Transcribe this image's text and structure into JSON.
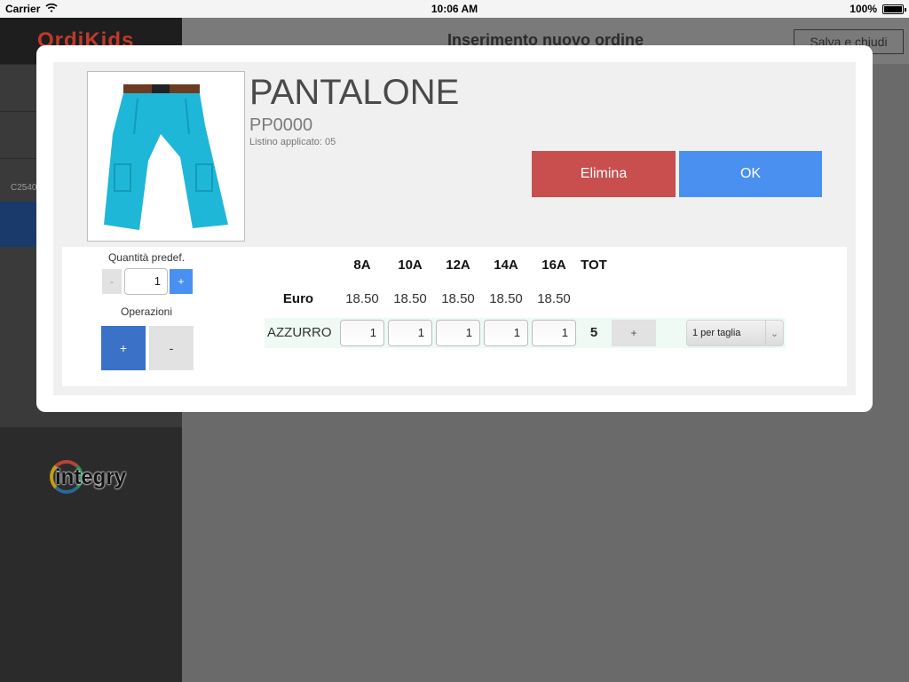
{
  "status_bar": {
    "carrier": "Carrier",
    "time": "10:06 AM",
    "battery": "100%"
  },
  "background": {
    "sidebar": {
      "logo": "OrdiKids",
      "code": "C2540",
      "brand": "integry"
    },
    "header": {
      "title": "Inserimento nuovo ordine",
      "save_label": "Salva e chiudi"
    }
  },
  "modal": {
    "product": {
      "name": "PANTALONE",
      "code": "PP0000",
      "listino": "Listino applicato: 05",
      "image_icon": "pants-image"
    },
    "actions": {
      "delete_label": "Elimina",
      "ok_label": "OK"
    },
    "quantity": {
      "label": "Quantità predef.",
      "minus": "-",
      "value": "1",
      "plus": "+"
    },
    "operations": {
      "label": "Operazioni",
      "plus": "+",
      "minus": "-"
    },
    "grid": {
      "sizes": [
        "8A",
        "10A",
        "12A",
        "14A",
        "16A"
      ],
      "tot_header": "TOT",
      "price_label": "Euro",
      "prices": [
        "18.50",
        "18.50",
        "18.50",
        "18.50",
        "18.50"
      ],
      "rows": [
        {
          "color": "AZZURRO",
          "quantities": [
            "1",
            "1",
            "1",
            "1",
            "1"
          ],
          "total": "5",
          "add_label": "+",
          "distribution": "1 per taglia"
        }
      ]
    }
  },
  "colors": {
    "delete": "#c94f4f",
    "ok": "#4a90f0",
    "operations_plus": "#3b72c8",
    "row_highlight": "#eefaf3"
  }
}
